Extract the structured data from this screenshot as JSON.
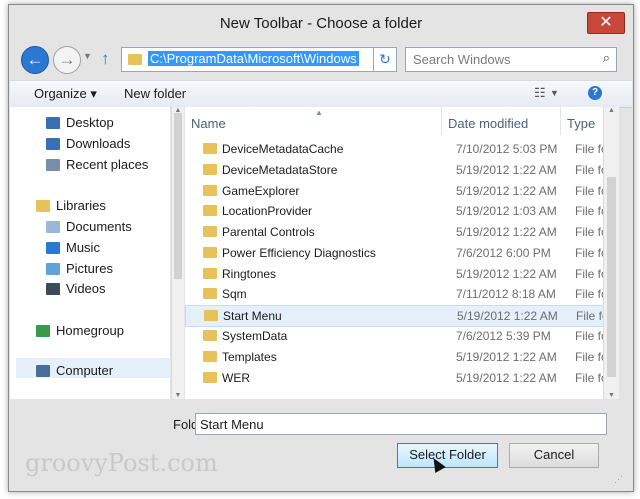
{
  "window": {
    "title": "New Toolbar - Choose a folder",
    "close_glyph": "✕"
  },
  "address": {
    "path": "C:\\ProgramData\\Microsoft\\Windows",
    "search_placeholder": "Search Windows"
  },
  "commands": {
    "organize": "Organize ▾",
    "new_folder": "New folder"
  },
  "nav": {
    "items": [
      {
        "label": "Desktop",
        "icon": "desktop-icon",
        "color": "#3a6fb6"
      },
      {
        "label": "Downloads",
        "icon": "downloads-icon",
        "color": "#3a6fb6"
      },
      {
        "label": "Recent places",
        "icon": "recent-places-icon",
        "color": "#7a8da8"
      },
      {
        "label": "Libraries",
        "icon": "libraries-icon",
        "color": "#e7c25a"
      },
      {
        "label": "Documents",
        "icon": "documents-icon",
        "color": "#9ab7d8"
      },
      {
        "label": "Music",
        "icon": "music-icon",
        "color": "#2a78d2"
      },
      {
        "label": "Pictures",
        "icon": "pictures-icon",
        "color": "#5fa3d8"
      },
      {
        "label": "Videos",
        "icon": "videos-icon",
        "color": "#3d4a5a"
      },
      {
        "label": "Homegroup",
        "icon": "homegroup-icon",
        "color": "#3b9a4a"
      },
      {
        "label": "Computer",
        "icon": "computer-icon",
        "color": "#4a6e9a"
      }
    ]
  },
  "columns": {
    "name": "Name",
    "date": "Date modified",
    "type": "Type"
  },
  "files": [
    {
      "name": "DeviceMetadataCache",
      "date": "7/10/2012 5:03 PM",
      "type": "File fol"
    },
    {
      "name": "DeviceMetadataStore",
      "date": "5/19/2012 1:22 AM",
      "type": "File fol"
    },
    {
      "name": "GameExplorer",
      "date": "5/19/2012 1:22 AM",
      "type": "File fol"
    },
    {
      "name": "LocationProvider",
      "date": "5/19/2012 1:03 AM",
      "type": "File fol"
    },
    {
      "name": "Parental Controls",
      "date": "5/19/2012 1:22 AM",
      "type": "File fol"
    },
    {
      "name": "Power Efficiency Diagnostics",
      "date": "7/6/2012 6:00 PM",
      "type": "File fol"
    },
    {
      "name": "Ringtones",
      "date": "5/19/2012 1:22 AM",
      "type": "File fol"
    },
    {
      "name": "Sqm",
      "date": "7/11/2012 8:18 AM",
      "type": "File fol"
    },
    {
      "name": "Start Menu",
      "date": "5/19/2012 1:22 AM",
      "type": "File fol",
      "selected": true
    },
    {
      "name": "SystemData",
      "date": "7/6/2012 5:39 PM",
      "type": "File fol"
    },
    {
      "name": "Templates",
      "date": "5/19/2012 1:22 AM",
      "type": "File fol"
    },
    {
      "name": "WER",
      "date": "5/19/2012 1:22 AM",
      "type": "File fol"
    }
  ],
  "folder": {
    "label": "Folder:",
    "value": "Start Menu"
  },
  "buttons": {
    "select": "Select Folder",
    "cancel": "Cancel"
  },
  "watermark": "groovyPost.com"
}
